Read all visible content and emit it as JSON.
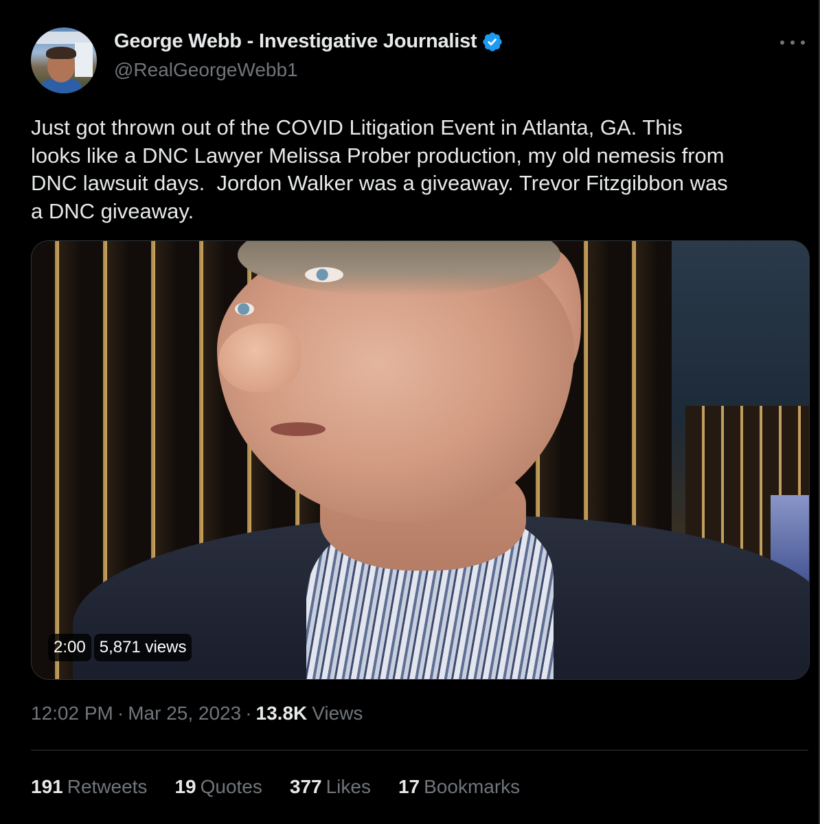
{
  "author": {
    "display_name": "George Webb - Investigative Journalist",
    "handle": "@RealGeorgeWebb1",
    "verified_icon": "verified-badge-icon",
    "accent": "#1d9bf0"
  },
  "tweet": {
    "text": "Just got thrown out of the COVID Litigation Event in Atlanta, GA. This\nlooks like a DNC Lawyer Melissa Prober production, my old nemesis from\nDNC lawsuit days.  Jordon Walker was a giveaway. Trevor Fitzgibbon was\na DNC giveaway."
  },
  "video": {
    "duration": "2:00",
    "views": "5,871 views"
  },
  "meta": {
    "time": "12:02 PM",
    "separator": "·",
    "date": "Mar 25, 2023",
    "views_count": "13.8K",
    "views_label": "Views"
  },
  "stats": [
    {
      "count": "191",
      "label": "Retweets"
    },
    {
      "count": "19",
      "label": "Quotes"
    },
    {
      "count": "377",
      "label": "Likes"
    },
    {
      "count": "17",
      "label": "Bookmarks"
    }
  ]
}
